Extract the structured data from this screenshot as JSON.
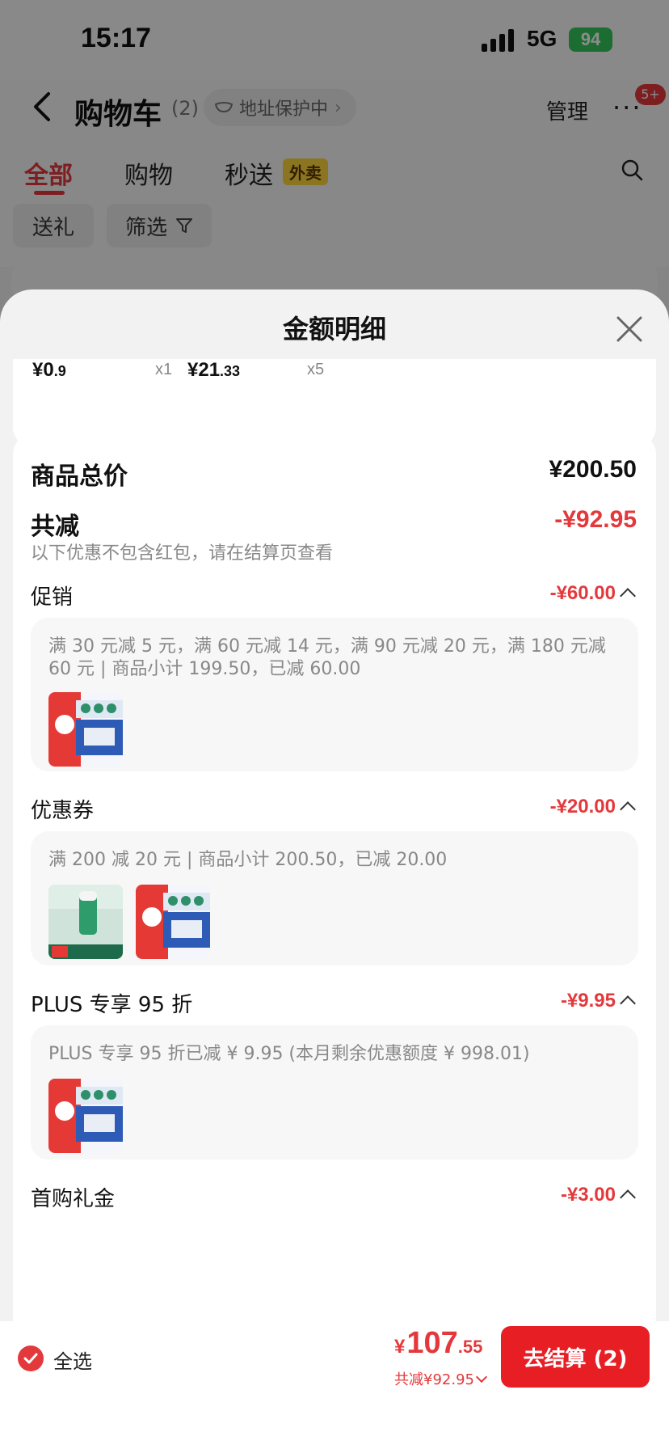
{
  "status_bar": {
    "time": "15:17",
    "network": "5G",
    "battery": "94"
  },
  "header": {
    "title": "购物车",
    "count": "(2)",
    "address_protection": "地址保护中",
    "manage": "管理",
    "more_badge": "5+",
    "tabs": [
      {
        "label": "全部"
      },
      {
        "label": "购物"
      },
      {
        "label": "秒送"
      }
    ],
    "waimai_tag": "外卖",
    "chips": [
      {
        "label": "送礼"
      },
      {
        "label": "筛选"
      }
    ]
  },
  "sheet": {
    "title": "金额明细",
    "items": [
      {
        "price_int": "¥0",
        "price_dec": ".9",
        "qty": "x1"
      },
      {
        "price_int": "¥21",
        "price_dec": ".33",
        "qty": "x5"
      }
    ],
    "total_label": "商品总价",
    "total_value": "¥200.50",
    "discount_label": "共减",
    "discount_value": "-¥92.95",
    "discount_note": "以下优惠不包含红包，请在结算页查看",
    "sections": [
      {
        "label": "促销",
        "value": "-¥60.00",
        "detail": "满 30 元减 5 元，满 60 元减 14 元，满 90 元减 20 元，满 180 元减 60 元 | 商品小计 199.50，已减 60.00",
        "thumbs": [
          "baby-wipes-product"
        ]
      },
      {
        "label": "优惠券",
        "value": "-¥20.00",
        "detail": "满 200 减 20 元 | 商品小计 200.50，已减 20.00",
        "thumbs": [
          "glue-stick-product",
          "baby-wipes-product"
        ]
      },
      {
        "label": "PLUS 专享 95 折",
        "value": "-¥9.95",
        "detail": "PLUS 专享 95 折已减 ¥ 9.95 (本月剩余优惠额度 ¥ 998.01)",
        "thumbs": [
          "baby-wipes-product"
        ]
      },
      {
        "label": "首购礼金",
        "value": "-¥3.00"
      }
    ]
  },
  "bottom_bar": {
    "select_all": "全选",
    "total_currency": "¥",
    "total_int": "107",
    "total_dec": ".55",
    "saved": "共减¥92.95",
    "checkout": "去结算 (2)"
  },
  "colors": {
    "accent": "#e4393c",
    "checkout_bg": "#e81e25",
    "battery": "#34c759"
  }
}
